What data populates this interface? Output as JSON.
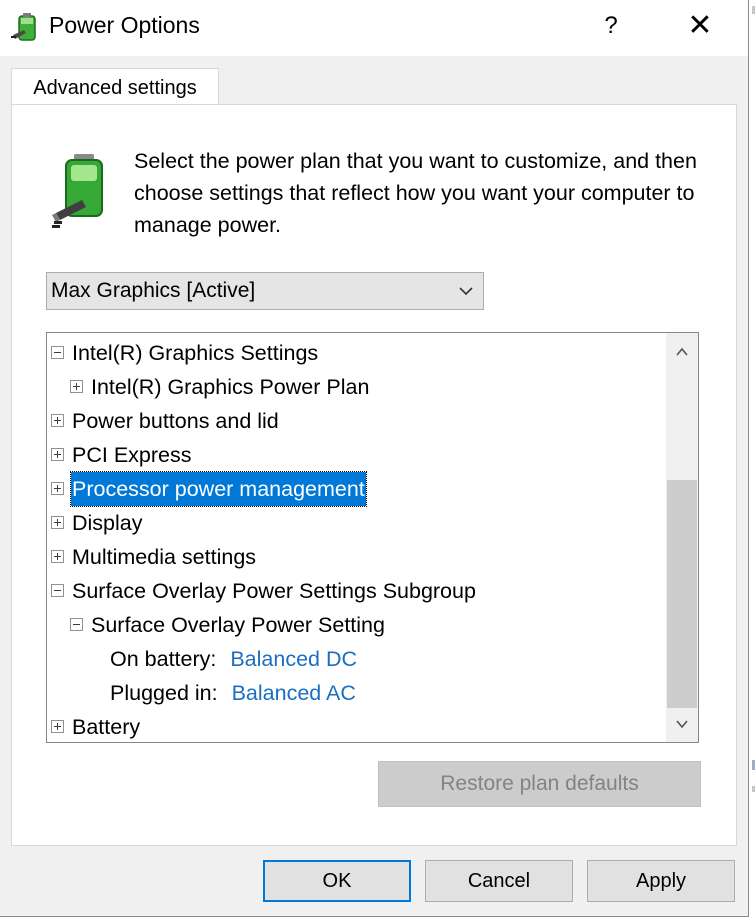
{
  "window": {
    "title": "Power Options",
    "title_icon": "power-options-icon",
    "help_label": "?",
    "close_label": "✕"
  },
  "tabs": [
    {
      "label": "Advanced settings",
      "active": true
    }
  ],
  "description": "Select the power plan that you want to customize, and then choose settings that reflect how you want your computer to manage power.",
  "plan_select": {
    "selected": "Max Graphics [Active]"
  },
  "tree": {
    "items": [
      {
        "label": "Intel(R) Graphics Settings",
        "expander": "minus",
        "level": 0
      },
      {
        "label": "Intel(R) Graphics Power Plan",
        "expander": "plus",
        "level": 1
      },
      {
        "label": "Power buttons and lid",
        "expander": "plus",
        "level": 0
      },
      {
        "label": "PCI Express",
        "expander": "plus",
        "level": 0
      },
      {
        "label": "Processor power management",
        "expander": "plus",
        "level": 0,
        "selected": true
      },
      {
        "label": "Display",
        "expander": "plus",
        "level": 0
      },
      {
        "label": "Multimedia settings",
        "expander": "plus",
        "level": 0
      },
      {
        "label": "Surface Overlay Power Settings Subgroup",
        "expander": "minus",
        "level": 0
      },
      {
        "label": "Surface Overlay Power Setting",
        "expander": "minus",
        "level": 1
      },
      {
        "label": "On battery:",
        "value": "Balanced DC",
        "level": 2
      },
      {
        "label": "Plugged in:",
        "value": "Balanced AC",
        "level": 2
      },
      {
        "label": "Battery",
        "expander": "plus",
        "level": 0
      }
    ]
  },
  "restore_button": "Restore plan defaults",
  "buttons": {
    "ok": "OK",
    "cancel": "Cancel",
    "apply": "Apply"
  },
  "colors": {
    "selection": "#0078d7",
    "link": "#1a6fc2",
    "dialog_bg": "#f0f0f0"
  }
}
